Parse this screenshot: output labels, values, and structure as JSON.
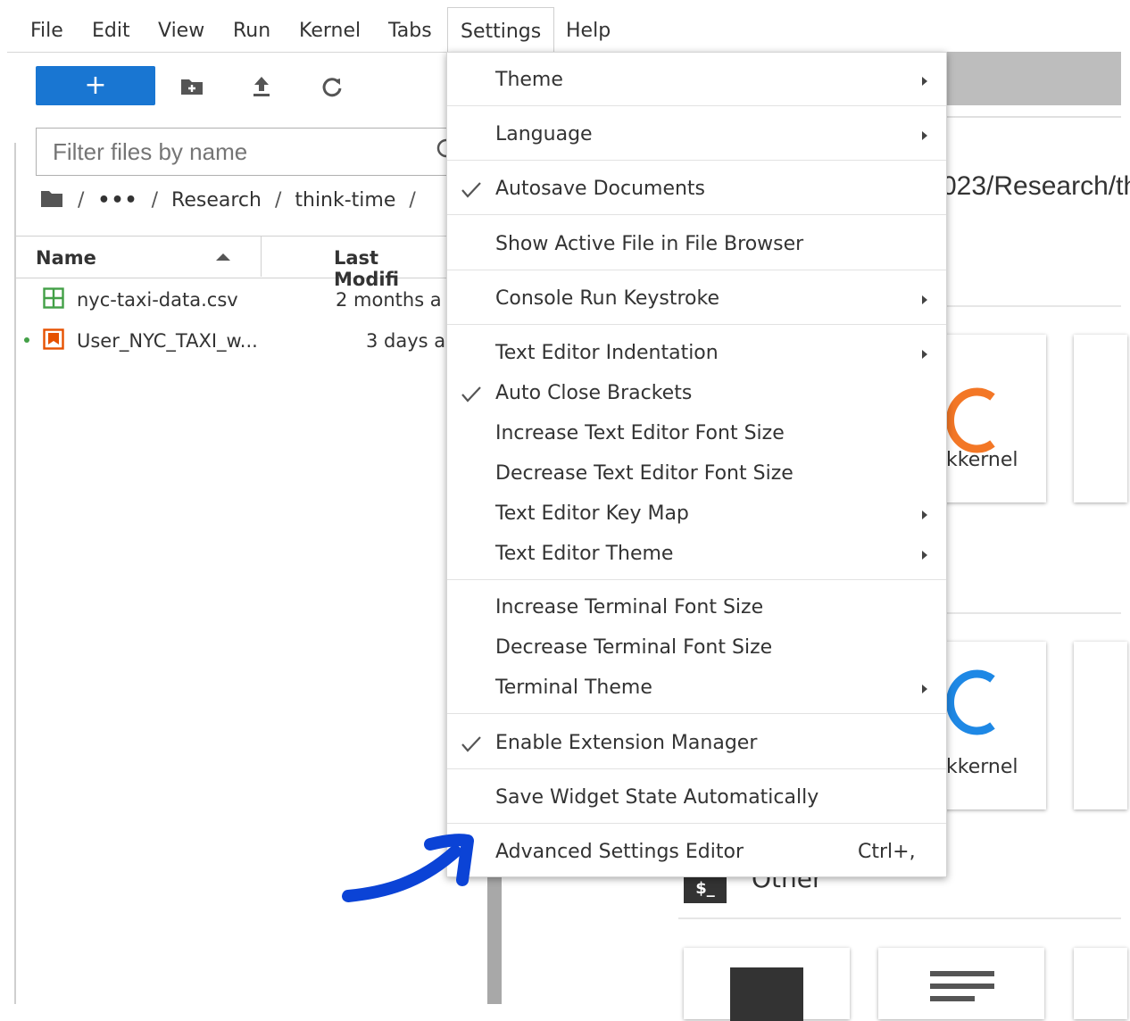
{
  "menubar": {
    "items": [
      "File",
      "Edit",
      "View",
      "Run",
      "Kernel",
      "Tabs",
      "Settings",
      "Help"
    ],
    "active": "Settings"
  },
  "toolbar": {
    "new_label": "+",
    "icons": [
      "new-folder-icon",
      "upload-icon",
      "refresh-icon"
    ]
  },
  "filter": {
    "placeholder": "Filter files by name"
  },
  "breadcrumb": {
    "root_icon": "folder-icon",
    "ellipsis": "•••",
    "research": "Research",
    "current": "think-time",
    "sep": "/"
  },
  "listing": {
    "name_header": "Name",
    "modified_header": "Last Modifi",
    "files": [
      {
        "icon": "spreadsheet-icon",
        "name": "nyc-taxi-data.csv",
        "modified": "2 months a",
        "running": false
      },
      {
        "icon": "notebook-icon",
        "name": "User_NYC_TAXI_w...",
        "modified": "3 days a",
        "running": true
      }
    ]
  },
  "launcher": {
    "path": "023/Research/th",
    "kernel_label_1": "kkernel",
    "kernel_label_2": "kkernel",
    "other_heading": "Other",
    "terminal_icon_text": "$_"
  },
  "settings_menu": {
    "items": [
      {
        "label": "Theme",
        "checked": false,
        "submenu": true
      },
      {
        "label": "Language",
        "checked": false,
        "submenu": true
      },
      {
        "label": "Autosave Documents",
        "checked": true,
        "submenu": false
      },
      {
        "label": "Show Active File in File Browser",
        "checked": false,
        "submenu": false
      },
      {
        "label": "Console Run Keystroke",
        "checked": false,
        "submenu": true
      },
      {
        "label": "Text Editor Indentation",
        "checked": false,
        "submenu": true
      },
      {
        "label": "Auto Close Brackets",
        "checked": true,
        "submenu": false
      },
      {
        "label": "Increase Text Editor Font Size",
        "checked": false,
        "submenu": false
      },
      {
        "label": "Decrease Text Editor Font Size",
        "checked": false,
        "submenu": false
      },
      {
        "label": "Text Editor Key Map",
        "checked": false,
        "submenu": true
      },
      {
        "label": "Text Editor Theme",
        "checked": false,
        "submenu": true
      },
      {
        "label": "Increase Terminal Font Size",
        "checked": false,
        "submenu": false
      },
      {
        "label": "Decrease Terminal Font Size",
        "checked": false,
        "submenu": false
      },
      {
        "label": "Terminal Theme",
        "checked": false,
        "submenu": true
      },
      {
        "label": "Enable Extension Manager",
        "checked": true,
        "submenu": false
      },
      {
        "label": "Save Widget State Automatically",
        "checked": false,
        "submenu": false
      },
      {
        "label": "Advanced Settings Editor",
        "checked": false,
        "submenu": false,
        "shortcut": "Ctrl+,"
      }
    ]
  },
  "colors": {
    "accent": "#1976d2",
    "annotation": "#0b43d6",
    "kernel_orange": "#f37726",
    "kernel_blue": "#1e88e5",
    "spreadsheet_green": "#43a047",
    "notebook_orange": "#e65100"
  }
}
